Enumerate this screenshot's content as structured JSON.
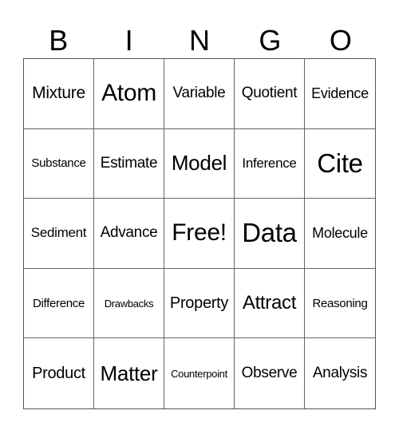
{
  "header": {
    "letters": [
      "B",
      "I",
      "N",
      "G",
      "O"
    ]
  },
  "grid": {
    "rows": [
      [
        "Mixture",
        "Atom",
        "Variable",
        "Quotient",
        "Evidence"
      ],
      [
        "Substance",
        "Estimate",
        "Model",
        "Inference",
        "Cite"
      ],
      [
        "Sediment",
        "Advance",
        "Free!",
        "Data",
        "Molecule"
      ],
      [
        "Difference",
        "Drawbacks",
        "Property",
        "Attract",
        "Reasoning"
      ],
      [
        "Product",
        "Matter",
        "Counterpoint",
        "Observe",
        "Analysis"
      ]
    ]
  }
}
